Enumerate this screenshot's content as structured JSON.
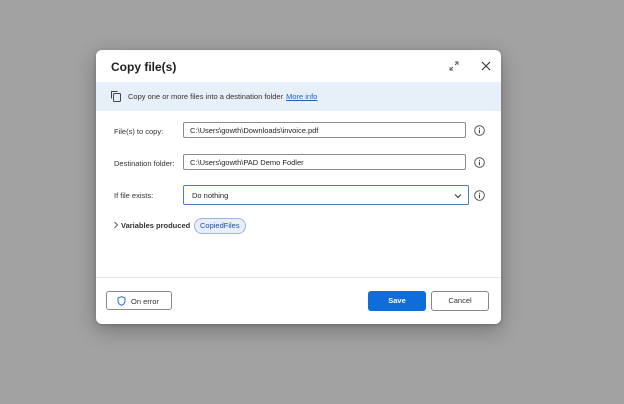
{
  "dialog": {
    "title": "Copy file(s)",
    "banner": {
      "text": "Copy one or more files into a destination folder",
      "link": "More info"
    },
    "fields": {
      "files_to_copy": {
        "label": "File(s) to copy:",
        "value": "C:\\Users\\gowth\\Downloads\\invoice.pdf"
      },
      "destination": {
        "label": "Destination folder:",
        "value": "C:\\Users\\gowth\\PAD Demo Fodler"
      },
      "if_exists": {
        "label": "If file exists:",
        "value": "Do nothing"
      }
    },
    "variables": {
      "label": "Variables produced",
      "chip": "CopiedFiles"
    },
    "footer": {
      "on_error": "On error",
      "save": "Save",
      "cancel": "Cancel"
    }
  },
  "colors": {
    "primary": "#0f6cdb",
    "banner_bg": "#e7eff9",
    "link": "#1c5fc4",
    "overlay": "#a2a2a2"
  },
  "icons": [
    "expand-icon",
    "close-icon",
    "copy-files-icon",
    "info-icon",
    "chevron-down-icon",
    "chevron-right-icon",
    "shield-icon"
  ]
}
